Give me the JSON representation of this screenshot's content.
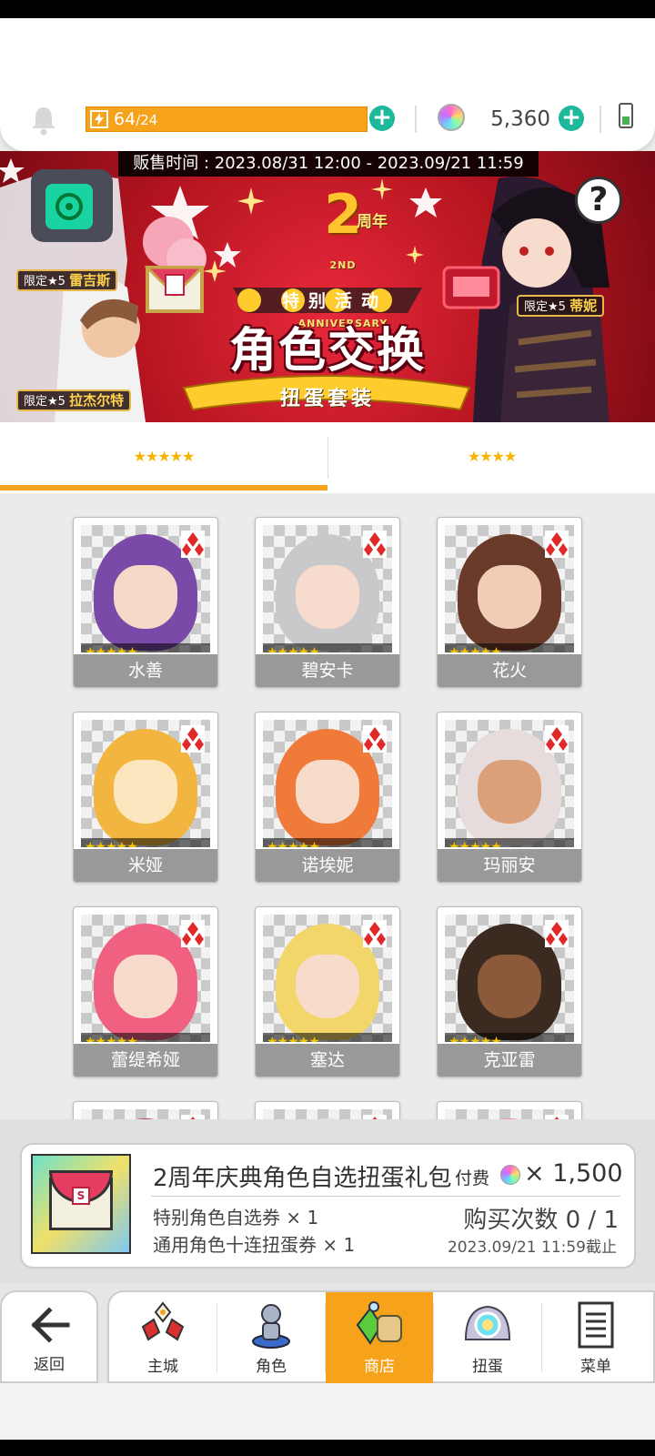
{
  "hud": {
    "energy_current": "64",
    "energy_max": "/24",
    "gems": "5,360"
  },
  "banner": {
    "sale_time": "贩售时间 : 2023.08/31 12:00 - 2023.09/21 11:59",
    "anniversary_number": "2",
    "anniversary_zh": "周年",
    "anniversary_en": "2ND ANNIVERSARY",
    "event_label": "特别活动",
    "main_title": "角色交换",
    "subtitle": "扭蛋套装",
    "featured": [
      {
        "tag": "限定★5",
        "name": "雷吉斯"
      },
      {
        "tag": "限定★5",
        "name": "拉杰尔特"
      },
      {
        "tag": "限定★5",
        "name": "蒂妮"
      }
    ],
    "help_label": "?"
  },
  "tabs": [
    {
      "label": "★★★★★",
      "active": true
    },
    {
      "label": "★★★★",
      "active": false
    }
  ],
  "characters": [
    {
      "name": "水善",
      "stars": "★★★★★",
      "hair": "#7a4aa8",
      "skin": "#f6d8c8"
    },
    {
      "name": "碧安卡",
      "stars": "★★★★★",
      "hair": "#c9c9cc",
      "skin": "#f7dccd"
    },
    {
      "name": "花火",
      "stars": "★★★★★",
      "hair": "#6a3a2a",
      "skin": "#f2cdb5"
    },
    {
      "name": "米娅",
      "stars": "★★★★★",
      "hair": "#f2b640",
      "skin": "#fbe6c0"
    },
    {
      "name": "诺埃妮",
      "stars": "★★★★★",
      "hair": "#f07a3a",
      "skin": "#f8dccb"
    },
    {
      "name": "玛丽安",
      "stars": "★★★★★",
      "hair": "#e6dcdc",
      "skin": "#d9a07a"
    },
    {
      "name": "蕾缇希娅",
      "stars": "★★★★★",
      "hair": "#f06080",
      "skin": "#f8dccb"
    },
    {
      "name": "塞达",
      "stars": "★★★★★",
      "hair": "#f2d66a",
      "skin": "#f8dccb"
    },
    {
      "name": "克亚雷",
      "stars": "★★★★★",
      "hair": "#3a2a20",
      "skin": "#8a5a3a"
    },
    {
      "name": "",
      "stars": "",
      "hair": "#c03a4a",
      "skin": "#f8dccb"
    },
    {
      "name": "",
      "stars": "",
      "hair": "#e8e0e0",
      "skin": "#f8dccb"
    },
    {
      "name": "",
      "stars": "",
      "hair": "#f28aa0",
      "skin": "#f8dccb"
    }
  ],
  "pack": {
    "title": "2周年庆典角色自选扭蛋礼包",
    "pay_label": "付费",
    "price": "× 1,500",
    "icon_seal": "S",
    "items": [
      "特别角色自选券 × 1",
      "通用角色十连扭蛋券 × 1"
    ],
    "purchase_count": "购买次数 0 / 1",
    "deadline": "2023.09/21 11:59截止"
  },
  "nav": {
    "back": "返回",
    "items": [
      {
        "label": "主城",
        "icon": "castle-icon",
        "active": false
      },
      {
        "label": "角色",
        "icon": "character-icon",
        "active": false
      },
      {
        "label": "商店",
        "icon": "shop-icon",
        "active": true
      },
      {
        "label": "扭蛋",
        "icon": "gacha-icon",
        "active": false
      },
      {
        "label": "菜单",
        "icon": "menu-icon",
        "active": false
      }
    ]
  },
  "colors": {
    "accent": "#f7a21b",
    "plus": "#1eb89a",
    "star": "#f5c400"
  }
}
